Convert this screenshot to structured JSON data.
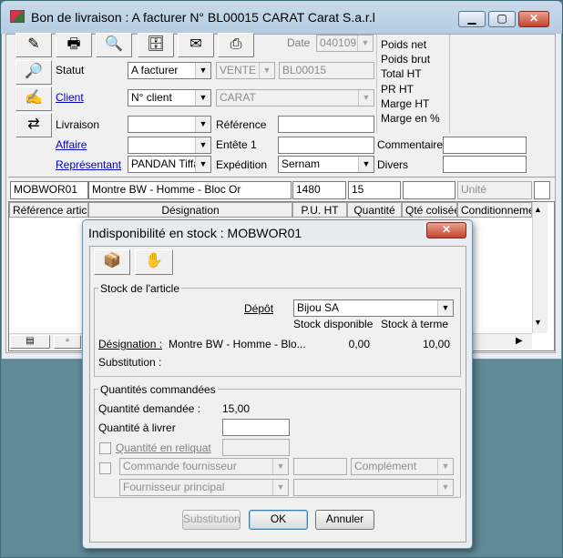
{
  "window": {
    "title": "Bon de livraison : A facturer N° BL00015 CARAT Carat S.a.r.l",
    "date_label": "Date",
    "date_value": "040109"
  },
  "toolbar_icons": [
    "edit-doc-icon",
    "print-doc-icon",
    "search-doc-icon",
    "archive-doc-icon",
    "email-doc-icon",
    "printer-icon",
    "search-client-icon",
    "sign-doc-icon",
    "transfer-doc-icon"
  ],
  "form": {
    "statut_label": "Statut",
    "statut_value": "A facturer",
    "type_value": "VENTE",
    "numero_value": "BL00015",
    "client_label": "Client",
    "client_mode_value": "N° client",
    "client_value": "CARAT",
    "livraison_label": "Livraison",
    "livraison_value": "",
    "reference_label": "Référence",
    "reference_value": "",
    "affaire_label": "Affaire",
    "affaire_value": "",
    "entete_label": "Entête 1",
    "entete_value": "",
    "commentaires_label": "Commentaires",
    "commentaires_value": "",
    "representant_label": "Représentant",
    "representant_value": "PANDAN Tiffa",
    "expedition_label": "Expédition",
    "expedition_value": "Sernam",
    "divers_label": "Divers",
    "divers_value": ""
  },
  "totals": {
    "poids_net": "Poids net",
    "poids_brut": "Poids brut",
    "total_ht": "Total HT",
    "pr_ht": "PR HT",
    "marge_ht": "Marge HT",
    "marge_pct": "Marge en %"
  },
  "entry_row": {
    "reference": "MOBWOR01",
    "designation": "Montre BW - Homme - Bloc Or",
    "pu_ht": "1480",
    "quantite": "15",
    "qte_colisee": "",
    "unite_placeholder": "Unité"
  },
  "grid_headers": [
    "Référence article",
    "Désignation",
    "P.U. HT",
    "Quantité",
    "Qté colisée",
    "Conditionnement"
  ],
  "dialog": {
    "title": "Indisponibilité en stock : MOBWOR01",
    "stock_group_title": "Stock de l'article",
    "depot_label": "Dépôt",
    "depot_value": "Bijou SA",
    "stock_disponible_label": "Stock disponible",
    "stock_terme_label": "Stock à terme",
    "designation_label": "Désignation :",
    "designation_value": "Montre BW - Homme - Blo...",
    "stock_disponible_value": "0,00",
    "stock_terme_value": "10,00",
    "substitution_label": "Substitution :",
    "qty_group_title": "Quantités commandées",
    "quantite_demandee_label": "Quantité demandée :",
    "quantite_demandee_value": "15,00",
    "quantite_livrer_label": "Quantité à livrer",
    "quantite_livrer_value": "",
    "reliquat_label": "Quantité en reliquat",
    "commande_fournisseur_value": "Commande fournisseur",
    "complement_value": "Complément",
    "fournisseur_principal_value": "Fournisseur principal",
    "substitution_button": "Substitution",
    "ok_button": "OK",
    "annuler_button": "Annuler"
  }
}
